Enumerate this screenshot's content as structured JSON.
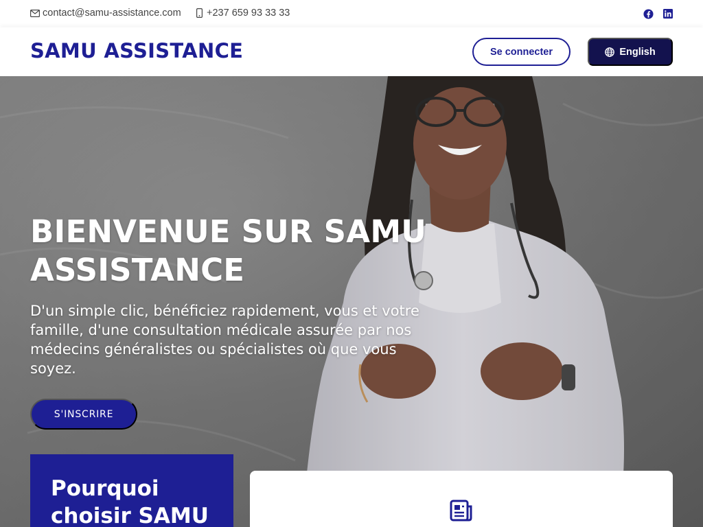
{
  "topbar": {
    "email": "contact@samu-assistance.com",
    "phone": "+237 659 93 33 33",
    "icons": {
      "email": "envelope-icon",
      "phone": "mobile-phone-icon",
      "facebook": "facebook-icon",
      "linkedin": "linkedin-icon"
    }
  },
  "navbar": {
    "brand": "SAMU ASSISTANCE",
    "login_label": "Se connecter",
    "language_label": "English",
    "language_icon": "globe-icon"
  },
  "hero": {
    "title": "BIENVENUE SUR SAMU ASSISTANCE",
    "subtitle": "D'un simple clic, bénéficiez rapidement, vous et votre famille, d'une consultation médicale assurée par nos médecins généralistes ou spécialistes où que vous soyez.",
    "signup_label": "S'INSCRIRE"
  },
  "why": {
    "title": "Pourquoi choisir SAMU"
  },
  "info_card": {
    "icon": "document-list-icon"
  },
  "colors": {
    "primary": "#1e1f94",
    "dark_button": "#13124e",
    "text_muted": "#444444",
    "white": "#ffffff"
  }
}
